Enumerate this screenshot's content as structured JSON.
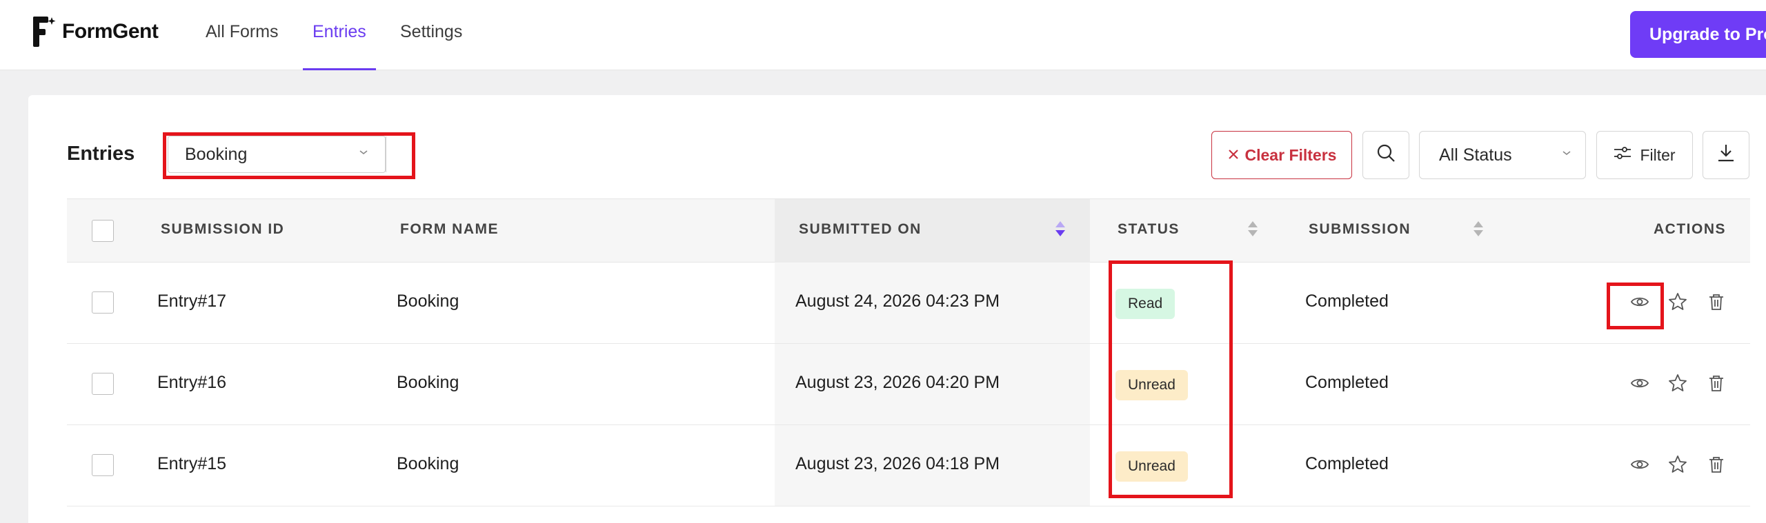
{
  "app": {
    "logo_text": "FormGent",
    "nav": [
      {
        "label": "All Forms"
      },
      {
        "label": "Entries"
      },
      {
        "label": "Settings"
      }
    ],
    "upgrade_label": "Upgrade to Pro"
  },
  "toolbar": {
    "title": "Entries",
    "form_select_value": "Booking",
    "clear_filters_label": "Clear Filters",
    "status_select_value": "All Status",
    "filter_label": "Filter"
  },
  "table": {
    "headers": {
      "submission_id": "SUBMISSION ID",
      "form_name": "FORM NAME",
      "submitted_on": "SUBMITTED ON",
      "status": "STATUS",
      "submission": "SUBMISSION",
      "actions": "ACTIONS"
    },
    "rows": [
      {
        "id": "Entry#17",
        "form": "Booking",
        "date": "August 24, 2026 04:23 PM",
        "status": "Read",
        "submission": "Completed"
      },
      {
        "id": "Entry#16",
        "form": "Booking",
        "date": "August 23, 2026 04:20 PM",
        "status": "Unread",
        "submission": "Completed"
      },
      {
        "id": "Entry#15",
        "form": "Booking",
        "date": "August 23, 2026 04:18 PM",
        "status": "Unread",
        "submission": "Completed"
      }
    ]
  },
  "colors": {
    "accent": "#6f3cf6",
    "danger": "#c8313f",
    "highlight": "#e4141b",
    "badge_read": "#d6f7e3",
    "badge_unread": "#fdecc8"
  },
  "icons": [
    "formgent-logo-icon",
    "close-icon",
    "search-icon",
    "chevron-down-icon",
    "filter-icon",
    "download-icon",
    "sort-icon",
    "eye-icon",
    "star-icon",
    "trash-icon"
  ]
}
